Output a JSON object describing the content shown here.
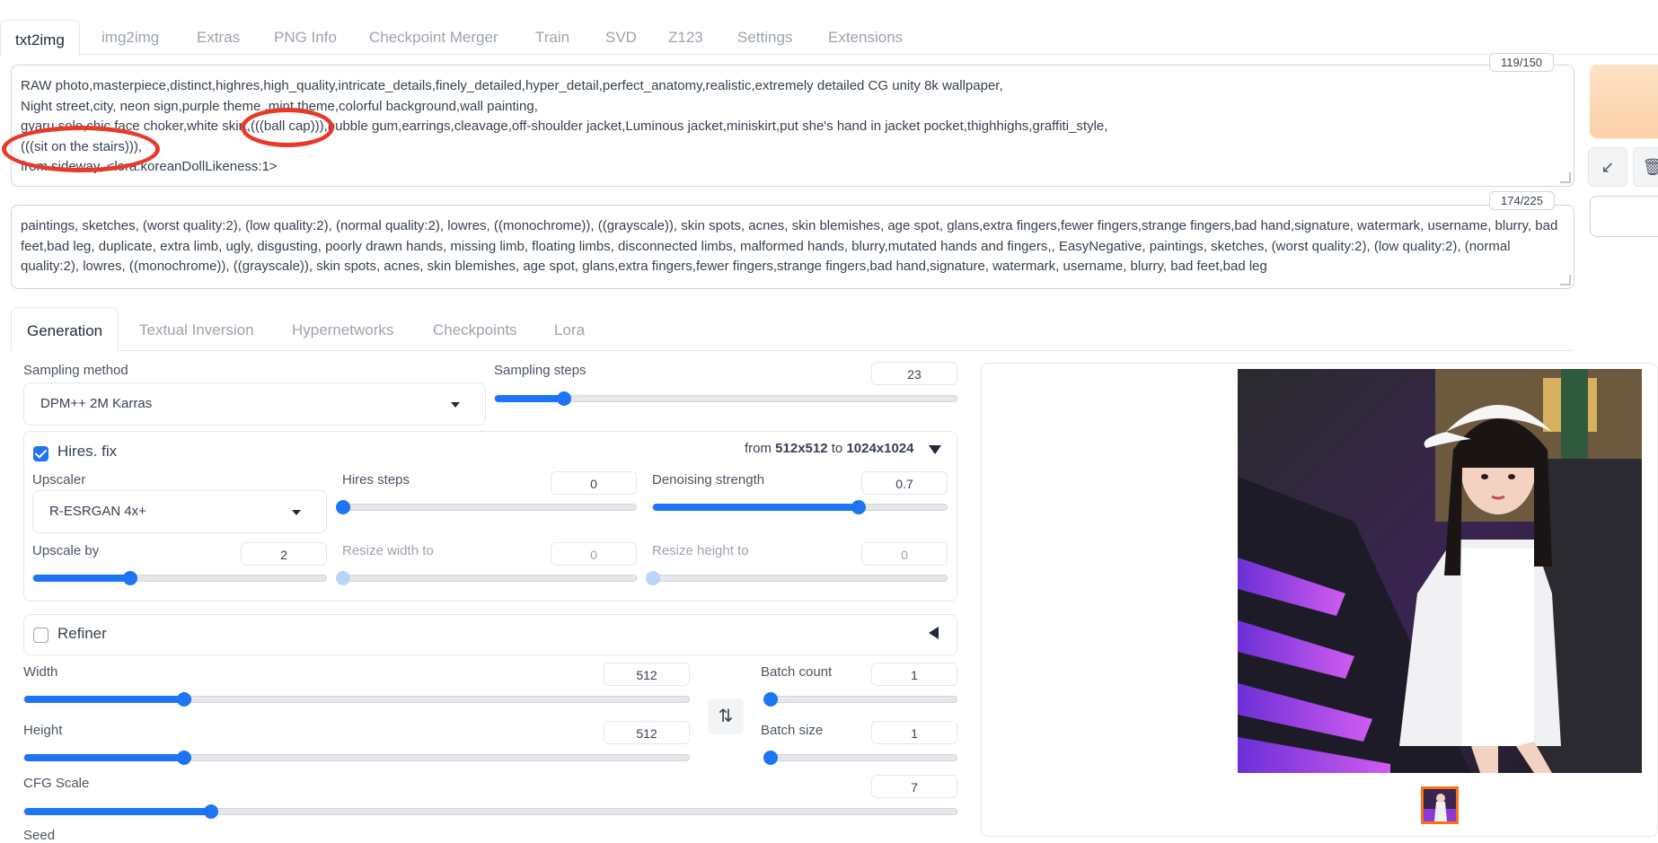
{
  "tabs": [
    "txt2img",
    "img2img",
    "Extras",
    "PNG Info",
    "Checkpoint Merger",
    "Train",
    "SVD",
    "Z123",
    "Settings",
    "Extensions"
  ],
  "prompt": {
    "lines": [
      "RAW photo,masterpiece,distinct,highres,high_quality,intricate_details,finely_detailed,hyper_detail,perfect_anatomy,realistic,extremely detailed CG unity 8k wallpaper,",
      "Night street,city, neon sign,purple theme ,mint theme,colorful background,wall painting,",
      "gyaru,solo,chic face choker,white skirt,(((ball cap))),bubble gum,earrings,cleavage,off-shoulder jacket,Luminous jacket,miniskirt,put she's hand in jacket pocket,thighhighs,graffiti_style,",
      "(((sit on the stairs))),",
      "from sideway, <lora:koreanDollLikeness:1>"
    ],
    "counter": "119/150"
  },
  "negative_prompt": {
    "text": "paintings, sketches, (worst quality:2), (low quality:2), (normal quality:2), lowres, ((monochrome)), ((grayscale)), skin spots, acnes, skin blemishes, age spot, glans,extra fingers,fewer fingers,strange fingers,bad hand,signature, watermark, username, blurry, bad feet,bad leg, duplicate, extra limb, ugly, disgusting, poorly drawn hands, missing limb, floating limbs, disconnected limbs, malformed hands, blurry,mutated hands and fingers,, EasyNegative, paintings, sketches, (worst quality:2), (low quality:2), (normal quality:2), lowres, ((monochrome)), ((grayscale)), skin spots, acnes, skin blemishes, age spot, glans,extra fingers,fewer fingers,strange fingers,bad hand,signature, watermark, username, blurry, bad feet,bad leg",
    "counter": "174/225"
  },
  "subtabs": [
    "Generation",
    "Textual Inversion",
    "Hypernetworks",
    "Checkpoints",
    "Lora"
  ],
  "sampling": {
    "method_label": "Sampling method",
    "method": "DPM++ 2M Karras",
    "steps_label": "Sampling steps",
    "steps": "23",
    "steps_fraction": 0.15
  },
  "hires": {
    "label": "Hires. fix",
    "from_label": "from",
    "from": "512x512",
    "to_label": "to",
    "to": "1024x1024",
    "upscaler_label": "Upscaler",
    "upscaler": "R-ESRGAN 4x+",
    "steps_label": "Hires steps",
    "steps": "0",
    "steps_fraction": 0.0,
    "denoise_label": "Denoising strength",
    "denoise": "0.7",
    "denoise_fraction": 0.7,
    "upscale_by_label": "Upscale by",
    "upscale_by": "2",
    "upscale_by_fraction": 0.33,
    "resize_w_label": "Resize width to",
    "resize_w": "0",
    "resize_h_label": "Resize height to",
    "resize_h": "0"
  },
  "refiner": {
    "label": "Refiner"
  },
  "size": {
    "width_label": "Width",
    "width": "512",
    "width_fraction": 0.24,
    "height_label": "Height",
    "height": "512",
    "height_fraction": 0.24,
    "swap_icon": "⇅"
  },
  "batch": {
    "count_label": "Batch count",
    "count": "1",
    "count_fraction": 0.0,
    "size_label": "Batch size",
    "size": "1",
    "size_fraction": 0.0
  },
  "cfg": {
    "label": "CFG Scale",
    "value": "7",
    "fraction": 0.2
  },
  "seed": {
    "label": "Seed"
  },
  "colors": {
    "accent": "#1d74f5",
    "annotation": "#e8392a",
    "selected_thumb": "#f97316"
  }
}
